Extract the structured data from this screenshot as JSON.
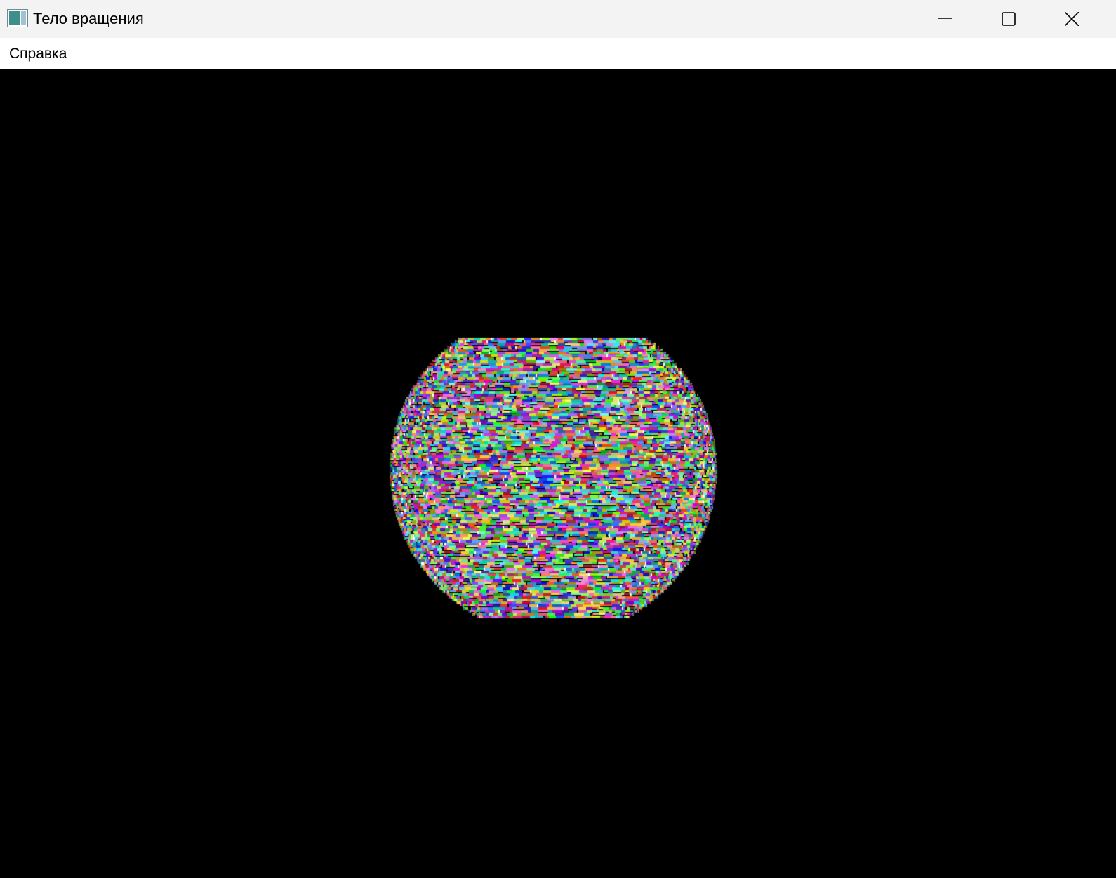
{
  "window": {
    "title": "Тело вращения",
    "app_icon": "app-window-icon",
    "controls": {
      "minimize_icon": "minimize-icon",
      "maximize_icon": "maximize-icon",
      "close_icon": "close-icon"
    }
  },
  "menubar": {
    "items": [
      {
        "label": "Справка"
      }
    ]
  },
  "viewport": {
    "background": "#000000",
    "object": "colorful-revolution-body"
  }
}
